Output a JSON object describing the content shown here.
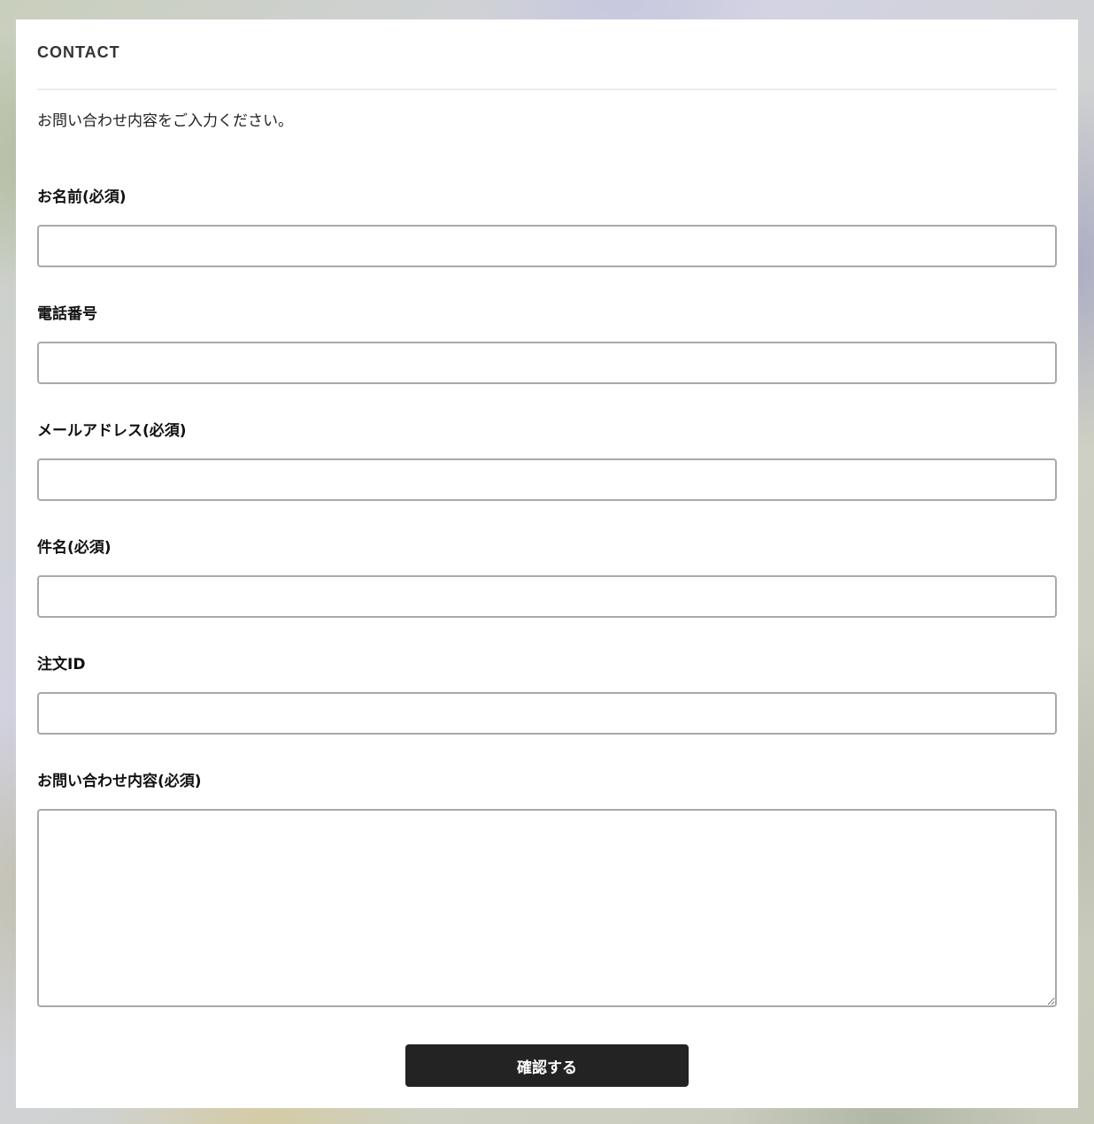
{
  "form": {
    "title": "CONTACT",
    "intro": "お問い合わせ内容をご入力ください。",
    "fields": [
      {
        "label": "お名前(必須)",
        "value": ""
      },
      {
        "label": "電話番号",
        "value": ""
      },
      {
        "label": "メールアドレス(必須)",
        "value": ""
      },
      {
        "label": "件名(必須)",
        "value": ""
      },
      {
        "label": "注文ID",
        "value": ""
      },
      {
        "label": "お問い合わせ内容(必須)",
        "value": ""
      }
    ],
    "submit_label": "確認する"
  },
  "colors": {
    "button_bg": "#232323",
    "input_border": "#a9a9ad",
    "card_bg": "#ffffff"
  }
}
